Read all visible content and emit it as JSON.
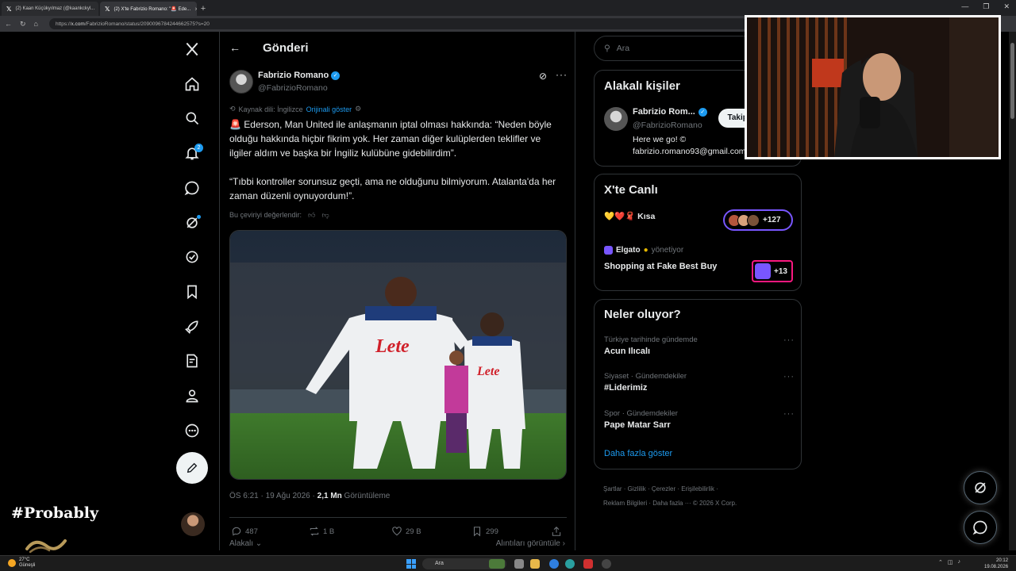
{
  "browser": {
    "tabs": [
      {
        "label": "(2) Kaan Küçükyılmaz (@kaankckyl..."
      },
      {
        "label": "(2) X'te Fabrizio Romano: \"🚨 Ede..."
      }
    ],
    "new_tab": "+",
    "url_prefix": "https://",
    "url_domain": "x.com",
    "url_path": "/FabrizioRomano/status/2090096784244662575?s=20"
  },
  "post_page": {
    "title": "Gönderi",
    "author": {
      "name": "Fabrizio Romano",
      "handle": "@FabrizioRomano"
    },
    "translation": {
      "source_label": "Kaynak dili: İngilizce",
      "show_original": "Orijinali göster"
    },
    "text_p1": "🚨 Ederson, Man United ile anlaşmanın iptal olması hakkında: “Neden böyle olduğu hakkında hiçbir fikrim yok. Her zaman diğer kulüplerden teklifler ve ilgiler aldım ve başka bir İngiliz kulübüne gidebilirdim”.",
    "text_p2": "“Tıbbi kontroller sorunsuz geçti, ama ne olduğunu bilmiyorum. Atalanta'da her zaman düzenli oynuyordum!”.",
    "rate_translation": "Bu çeviriyi değerlendir:",
    "shirt_sponsor": "Lete",
    "timestamp": "ÖS 6:21 · 19 Ağu 2026 · ",
    "views_count": "2,1 Mn",
    "views_label": " Görüntüleme",
    "stats": {
      "replies": "487",
      "reposts": "1 B",
      "likes": "29 B",
      "bookmarks": "299"
    },
    "sort_label": "Alakalı",
    "quotes_label": "Alıntıları görüntüle"
  },
  "right": {
    "search_placeholder": "Ara",
    "related": {
      "title": "Alakalı kişiler",
      "name": "Fabrizio Rom...",
      "handle": "@FabrizioRomano",
      "follow": "Takip et",
      "bio_line1": "Here we go! ©",
      "bio_line2": "fabrizio.romano93@gmail.com"
    },
    "live": {
      "title": "X'te Canlı",
      "space1_title": "💛❤️🧣 Kısa",
      "space1_count": "+127",
      "host_name": "Elgato",
      "host_role": "yönetiyor",
      "space2_title": "Shopping at Fake Best Buy",
      "space2_count": "+13"
    },
    "trends": {
      "title": "Neler oluyor?",
      "items": [
        {
          "meta": "Türkiye tarihinde gündemde",
          "name": "Acun Ilıcalı"
        },
        {
          "meta": "Siyaset · Gündemdekiler",
          "name": "#Liderimiz"
        },
        {
          "meta": "Spor · Gündemdekiler",
          "name": "Pape Matar Sarr"
        }
      ],
      "show_more": "Daha fazla göster"
    },
    "footer_line1": "Şartlar · Gizlilik · Çerezler · Erişilebilirlik ·",
    "footer_line2": "Reklam Bilgileri · Daha fazla ··· © 2026 X Corp."
  },
  "nav": {
    "notifications_badge": "2"
  },
  "overlay": {
    "tag": "#Probably"
  },
  "taskbar": {
    "temp": "27°C",
    "condition": "Güneşli",
    "search": "Ara",
    "time": "20:12",
    "date": "19.08.2026"
  },
  "colors": {
    "accent": "#1d9bf0",
    "background": "#000000",
    "border": "#2f3336",
    "muted": "#71767b"
  }
}
